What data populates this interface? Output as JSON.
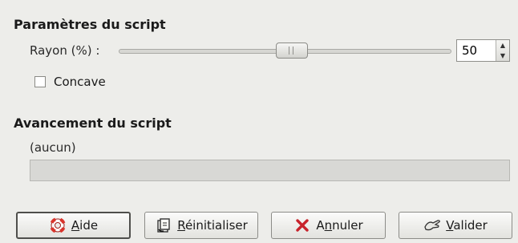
{
  "sections": {
    "params_title": "Paramètres du script",
    "progress_title": "Avancement du script"
  },
  "radius": {
    "label": "Rayon (%) :",
    "value": "50",
    "slider_fraction": 0.5
  },
  "concave": {
    "label": "Concave",
    "checked": false
  },
  "progress": {
    "status": "(aucun)",
    "fraction": 0
  },
  "buttons": {
    "help": {
      "mnemonic": "A",
      "rest": "ide",
      "icon": "help-lifebuoy-icon"
    },
    "reset": {
      "mnemonic": "R",
      "rest": "éinitialiser",
      "icon": "reset-icon"
    },
    "cancel": {
      "pre": "A",
      "mnemonic": "n",
      "rest": "nuler",
      "icon": "cancel-x-icon"
    },
    "ok": {
      "mnemonic": "V",
      "rest": "alider",
      "icon": "ok-hand-icon"
    }
  },
  "colors": {
    "cancel_icon": "#c8232c",
    "help_icon": "#d9342b"
  }
}
